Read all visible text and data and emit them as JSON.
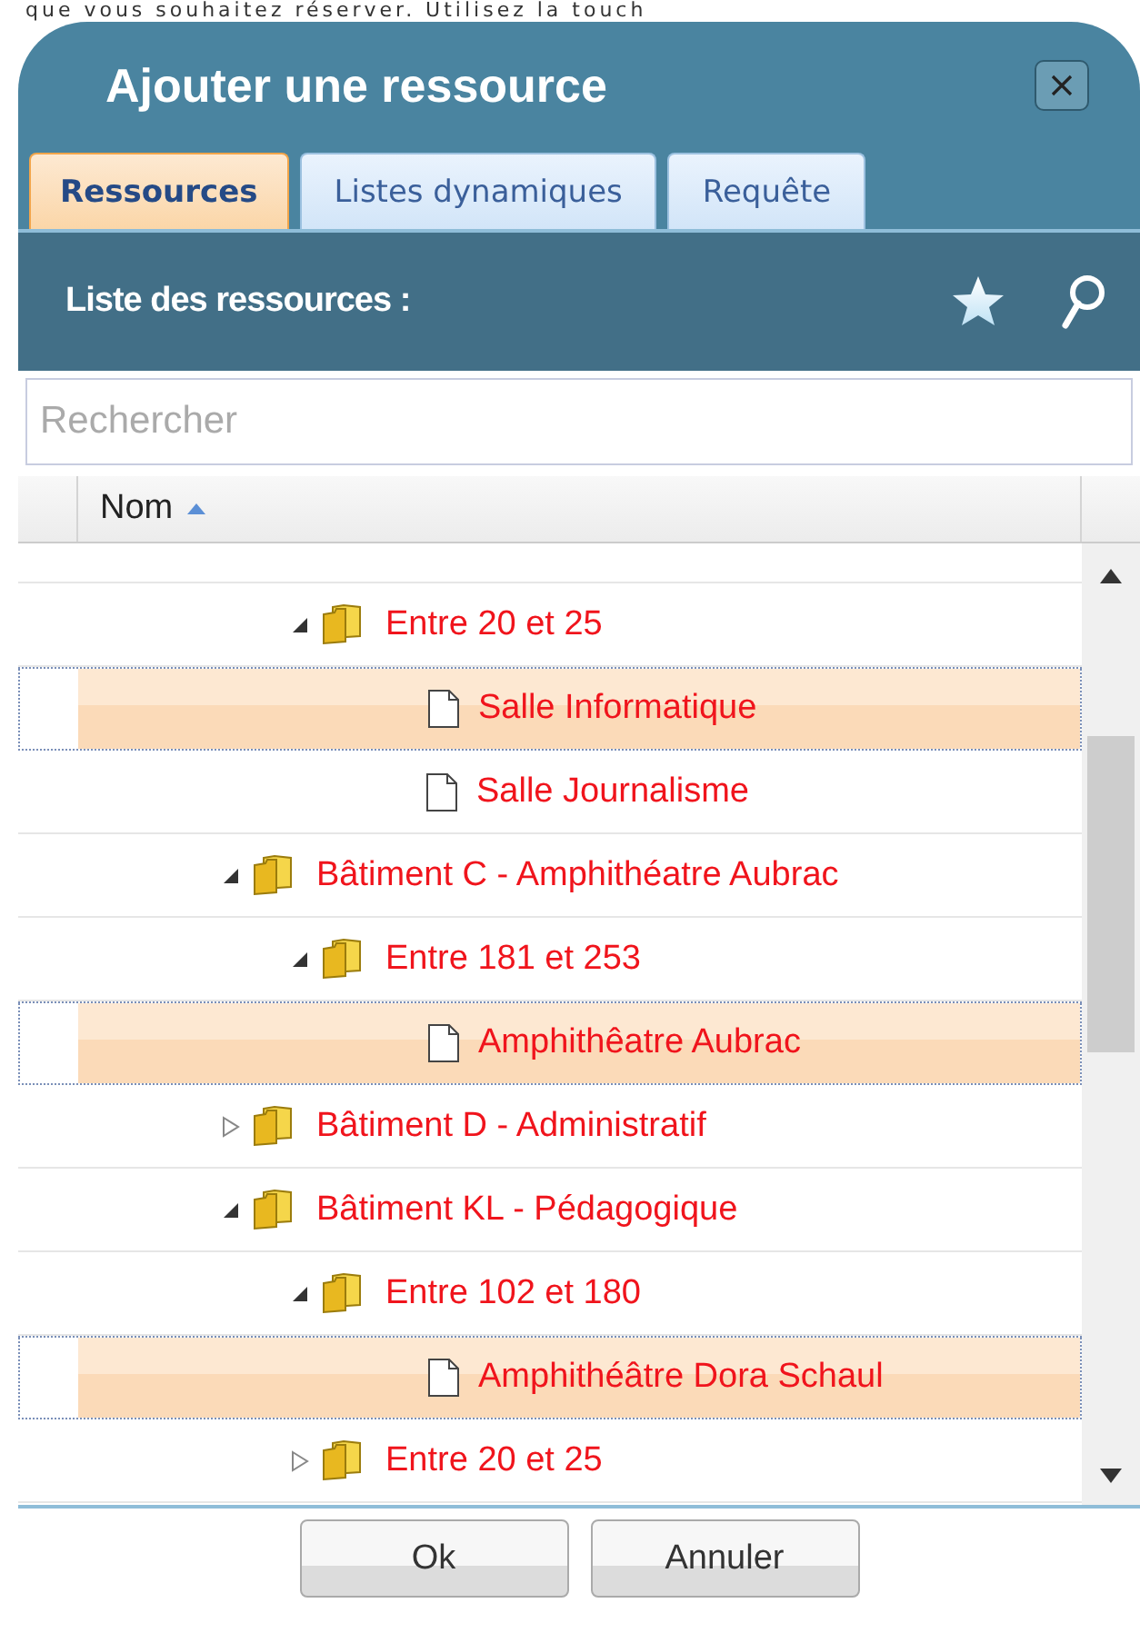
{
  "background_text": "que vous souhaitez réserver. Utilisez la touch",
  "dialog": {
    "title": "Ajouter une ressource"
  },
  "tabs": [
    {
      "label": "Ressources",
      "selected": true
    },
    {
      "label": "Listes dynamiques",
      "selected": false
    },
    {
      "label": "Requête",
      "selected": false
    }
  ],
  "list_header": {
    "title": "Liste des ressources :"
  },
  "search": {
    "placeholder": "Rechercher"
  },
  "table": {
    "columns": [
      {
        "label": "Nom",
        "sorted": true
      }
    ]
  },
  "tree": {
    "continued_items": [
      {
        "label": "Entre 20 et 25",
        "kind": "folder",
        "expanded": true,
        "selected": false,
        "children": [
          {
            "label": "Salle Informatique",
            "kind": "file",
            "selected": true
          },
          {
            "label": "Salle Journalisme",
            "kind": "file",
            "selected": false
          }
        ]
      }
    ],
    "items": [
      {
        "label": "Bâtiment C - Amphithéatre Aubrac",
        "kind": "folder",
        "expanded": true,
        "selected": false,
        "children": [
          {
            "label": "Entre 181 et 253",
            "kind": "folder",
            "expanded": true,
            "selected": false,
            "children": [
              {
                "label": "Amphithêatre Aubrac",
                "kind": "file",
                "selected": true
              }
            ]
          }
        ]
      },
      {
        "label": "Bâtiment D - Administratif",
        "kind": "folder",
        "expanded": false,
        "selected": false
      },
      {
        "label": "Bâtiment KL - Pédagogique",
        "kind": "folder",
        "expanded": true,
        "selected": false,
        "children": [
          {
            "label": "Entre 102 et 180",
            "kind": "folder",
            "expanded": true,
            "selected": false,
            "children": [
              {
                "label": "Amphithéâtre Dora Schaul",
                "kind": "file",
                "selected": true
              }
            ]
          },
          {
            "label": "Entre 20 et 25",
            "kind": "folder",
            "expanded": false,
            "selected": false
          }
        ]
      }
    ]
  },
  "buttons": [
    {
      "label": "Ok"
    },
    {
      "label": "Annuler"
    }
  ]
}
